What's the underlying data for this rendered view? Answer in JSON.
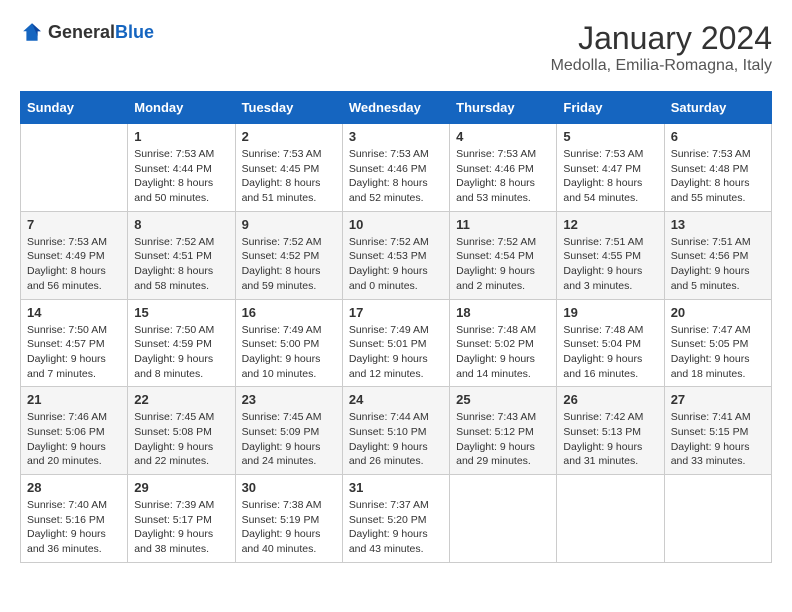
{
  "header": {
    "logo_general": "General",
    "logo_blue": "Blue",
    "month_year": "January 2024",
    "location": "Medolla, Emilia-Romagna, Italy"
  },
  "days_of_week": [
    "Sunday",
    "Monday",
    "Tuesday",
    "Wednesday",
    "Thursday",
    "Friday",
    "Saturday"
  ],
  "weeks": [
    [
      {
        "day": "",
        "info": ""
      },
      {
        "day": "1",
        "info": "Sunrise: 7:53 AM\nSunset: 4:44 PM\nDaylight: 8 hours\nand 50 minutes."
      },
      {
        "day": "2",
        "info": "Sunrise: 7:53 AM\nSunset: 4:45 PM\nDaylight: 8 hours\nand 51 minutes."
      },
      {
        "day": "3",
        "info": "Sunrise: 7:53 AM\nSunset: 4:46 PM\nDaylight: 8 hours\nand 52 minutes."
      },
      {
        "day": "4",
        "info": "Sunrise: 7:53 AM\nSunset: 4:46 PM\nDaylight: 8 hours\nand 53 minutes."
      },
      {
        "day": "5",
        "info": "Sunrise: 7:53 AM\nSunset: 4:47 PM\nDaylight: 8 hours\nand 54 minutes."
      },
      {
        "day": "6",
        "info": "Sunrise: 7:53 AM\nSunset: 4:48 PM\nDaylight: 8 hours\nand 55 minutes."
      }
    ],
    [
      {
        "day": "7",
        "info": "Sunrise: 7:53 AM\nSunset: 4:49 PM\nDaylight: 8 hours\nand 56 minutes."
      },
      {
        "day": "8",
        "info": "Sunrise: 7:52 AM\nSunset: 4:51 PM\nDaylight: 8 hours\nand 58 minutes."
      },
      {
        "day": "9",
        "info": "Sunrise: 7:52 AM\nSunset: 4:52 PM\nDaylight: 8 hours\nand 59 minutes."
      },
      {
        "day": "10",
        "info": "Sunrise: 7:52 AM\nSunset: 4:53 PM\nDaylight: 9 hours\nand 0 minutes."
      },
      {
        "day": "11",
        "info": "Sunrise: 7:52 AM\nSunset: 4:54 PM\nDaylight: 9 hours\nand 2 minutes."
      },
      {
        "day": "12",
        "info": "Sunrise: 7:51 AM\nSunset: 4:55 PM\nDaylight: 9 hours\nand 3 minutes."
      },
      {
        "day": "13",
        "info": "Sunrise: 7:51 AM\nSunset: 4:56 PM\nDaylight: 9 hours\nand 5 minutes."
      }
    ],
    [
      {
        "day": "14",
        "info": "Sunrise: 7:50 AM\nSunset: 4:57 PM\nDaylight: 9 hours\nand 7 minutes."
      },
      {
        "day": "15",
        "info": "Sunrise: 7:50 AM\nSunset: 4:59 PM\nDaylight: 9 hours\nand 8 minutes."
      },
      {
        "day": "16",
        "info": "Sunrise: 7:49 AM\nSunset: 5:00 PM\nDaylight: 9 hours\nand 10 minutes."
      },
      {
        "day": "17",
        "info": "Sunrise: 7:49 AM\nSunset: 5:01 PM\nDaylight: 9 hours\nand 12 minutes."
      },
      {
        "day": "18",
        "info": "Sunrise: 7:48 AM\nSunset: 5:02 PM\nDaylight: 9 hours\nand 14 minutes."
      },
      {
        "day": "19",
        "info": "Sunrise: 7:48 AM\nSunset: 5:04 PM\nDaylight: 9 hours\nand 16 minutes."
      },
      {
        "day": "20",
        "info": "Sunrise: 7:47 AM\nSunset: 5:05 PM\nDaylight: 9 hours\nand 18 minutes."
      }
    ],
    [
      {
        "day": "21",
        "info": "Sunrise: 7:46 AM\nSunset: 5:06 PM\nDaylight: 9 hours\nand 20 minutes."
      },
      {
        "day": "22",
        "info": "Sunrise: 7:45 AM\nSunset: 5:08 PM\nDaylight: 9 hours\nand 22 minutes."
      },
      {
        "day": "23",
        "info": "Sunrise: 7:45 AM\nSunset: 5:09 PM\nDaylight: 9 hours\nand 24 minutes."
      },
      {
        "day": "24",
        "info": "Sunrise: 7:44 AM\nSunset: 5:10 PM\nDaylight: 9 hours\nand 26 minutes."
      },
      {
        "day": "25",
        "info": "Sunrise: 7:43 AM\nSunset: 5:12 PM\nDaylight: 9 hours\nand 29 minutes."
      },
      {
        "day": "26",
        "info": "Sunrise: 7:42 AM\nSunset: 5:13 PM\nDaylight: 9 hours\nand 31 minutes."
      },
      {
        "day": "27",
        "info": "Sunrise: 7:41 AM\nSunset: 5:15 PM\nDaylight: 9 hours\nand 33 minutes."
      }
    ],
    [
      {
        "day": "28",
        "info": "Sunrise: 7:40 AM\nSunset: 5:16 PM\nDaylight: 9 hours\nand 36 minutes."
      },
      {
        "day": "29",
        "info": "Sunrise: 7:39 AM\nSunset: 5:17 PM\nDaylight: 9 hours\nand 38 minutes."
      },
      {
        "day": "30",
        "info": "Sunrise: 7:38 AM\nSunset: 5:19 PM\nDaylight: 9 hours\nand 40 minutes."
      },
      {
        "day": "31",
        "info": "Sunrise: 7:37 AM\nSunset: 5:20 PM\nDaylight: 9 hours\nand 43 minutes."
      },
      {
        "day": "",
        "info": ""
      },
      {
        "day": "",
        "info": ""
      },
      {
        "day": "",
        "info": ""
      }
    ]
  ]
}
